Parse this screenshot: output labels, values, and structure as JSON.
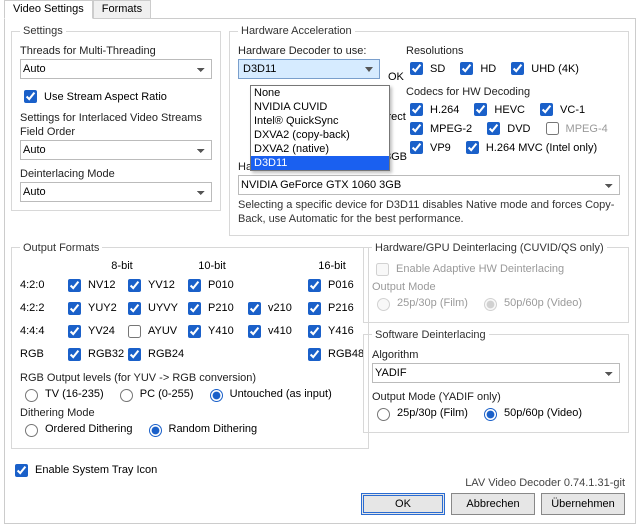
{
  "tabs": {
    "video": "Video Settings",
    "formats": "Formats"
  },
  "settings": {
    "legend": "Settings",
    "threads_label": "Threads for Multi-Threading",
    "threads_value": "Auto",
    "use_aspect": "Use Stream Aspect Ratio",
    "interlaced_legend": "Settings for Interlaced Video Streams",
    "field_order_label": "Field Order",
    "field_order_value": "Auto",
    "deint_label": "Deinterlacing Mode",
    "deint_value": "Auto"
  },
  "hwaccel": {
    "legend": "Hardware Acceleration",
    "decoder_label": "Hardware Decoder to use:",
    "decoder_value": "D3D11",
    "decoder_options": [
      "None",
      "NVIDIA CUVID",
      "Intel® QuickSync",
      "DXVA2 (copy-back)",
      "DXVA2 (native)",
      "D3D11"
    ],
    "ok": "OK",
    "direct_fragment": "irect",
    "threegb_fragment": "3GB",
    "res_legend": "Resolutions",
    "res": {
      "sd": "SD",
      "hd": "HD",
      "uhd": "UHD (4K)"
    },
    "codecs_legend": "Codecs for HW Decoding",
    "codecs": {
      "h264": "H.264",
      "hevc": "HEVC",
      "vc1": "VC-1",
      "mpeg2": "MPEG-2",
      "dvd": "DVD",
      "mpeg4": "MPEG-4",
      "vp9": "VP9",
      "h264mvc": "H.264 MVC (Intel only)"
    },
    "device_label": "Hardware Device to use:",
    "device_value": "NVIDIA GeForce GTX 1060 3GB",
    "note": "Selecting a specific device for D3D11 disables Native mode and forces Copy-Back, use Automatic for the best performance."
  },
  "outfmt": {
    "legend": "Output Formats",
    "cols": {
      "bit8": "8-bit",
      "bit10": "10-bit",
      "bit16": "16-bit"
    },
    "rows": {
      "r420": "4:2:0",
      "r422": "4:2:2",
      "r444": "4:4:4",
      "rgb": "RGB"
    },
    "f": {
      "nv12": "NV12",
      "yv12": "YV12",
      "p010": "P010",
      "p016": "P016",
      "yuy2": "YUY2",
      "uyvy": "UYVY",
      "p210": "P210",
      "v210": "v210",
      "p216": "P216",
      "yv24": "YV24",
      "ayuv": "AYUV",
      "y410": "Y410",
      "v410": "v410",
      "y416": "Y416",
      "rgb32": "RGB32",
      "rgb24": "RGB24",
      "rgb48": "RGB48"
    },
    "rgblevels_label": "RGB Output levels (for YUV -> RGB conversion)",
    "rgblevels": {
      "tv": "TV (16-235)",
      "pc": "PC (0-255)",
      "untouched": "Untouched (as input)"
    },
    "dither_label": "Dithering Mode",
    "dither": {
      "ordered": "Ordered Dithering",
      "random": "Random Dithering"
    }
  },
  "hwdi": {
    "legend": "Hardware/GPU Deinterlacing (CUVID/QS only)",
    "enable": "Enable Adaptive HW Deinterlacing",
    "outmode": "Output Mode",
    "film": "25p/30p (Film)",
    "video": "50p/60p (Video)"
  },
  "swdi": {
    "legend": "Software Deinterlacing",
    "algo_label": "Algorithm",
    "algo_value": "YADIF",
    "outmode": "Output Mode (YADIF only)",
    "film": "25p/30p (Film)",
    "video": "50p/60p (Video)"
  },
  "tray": "Enable System Tray Icon",
  "footer": "LAV Video Decoder 0.74.1.31-git",
  "buttons": {
    "ok": "OK",
    "cancel": "Abbrechen",
    "apply": "Übernehmen"
  }
}
